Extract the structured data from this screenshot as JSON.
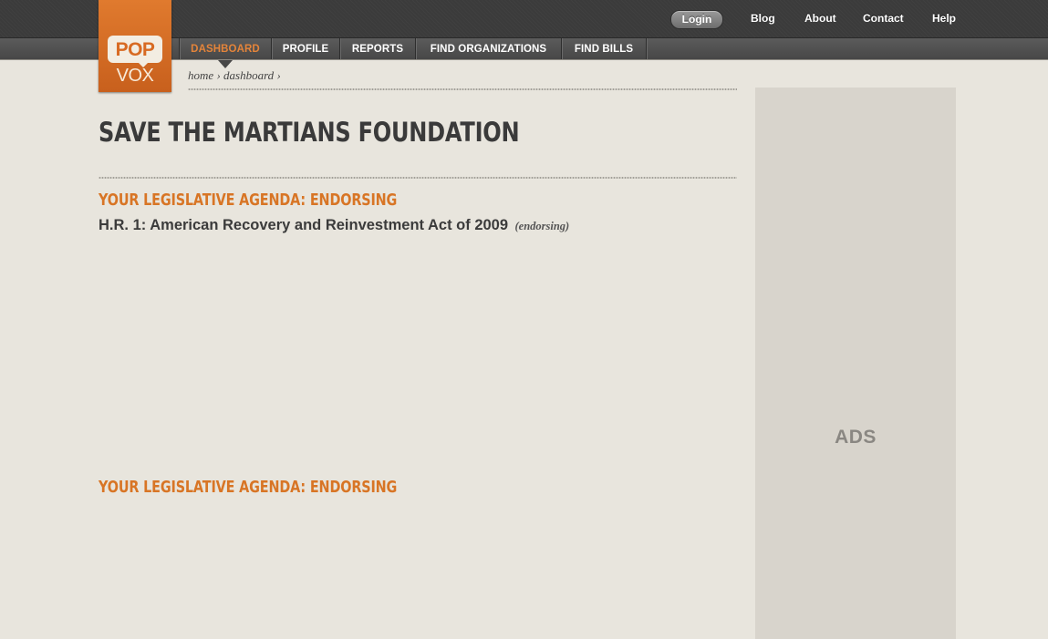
{
  "header": {
    "login_label": "Login",
    "links": [
      "Blog",
      "About",
      "Contact",
      "Help"
    ]
  },
  "logo": {
    "top_text": "POP",
    "bottom_text": "VOX"
  },
  "nav": {
    "active_index": 0,
    "items": [
      "DASHBOARD",
      "PROFILE",
      "REPORTS",
      "FIND ORGANIZATIONS",
      "FIND BILLS"
    ]
  },
  "breadcrumb": {
    "items": [
      "home",
      "dashboard"
    ],
    "separator": "›"
  },
  "page_title": "SAVE THE MARTIANS FOUNDATION",
  "agenda_sections": [
    {
      "heading": "YOUR LEGISLATIVE AGENDA: ENDORSING",
      "bills": [
        {
          "title": "H.R. 1: American Recovery and Reinvestment Act of 2009",
          "status": "(endorsing)"
        }
      ]
    },
    {
      "heading": "YOUR LEGISLATIVE AGENDA: ENDORSING",
      "bills": []
    }
  ],
  "sidebar": {
    "ads_label": "ADS"
  },
  "colors": {
    "background": "#e8e5dd",
    "topbar": "#3b3b3b",
    "navbar": "#4f4f4f",
    "accent_orange": "#d87525",
    "logo_orange": "#d86a22",
    "ads_panel": "#d8d4cc"
  }
}
